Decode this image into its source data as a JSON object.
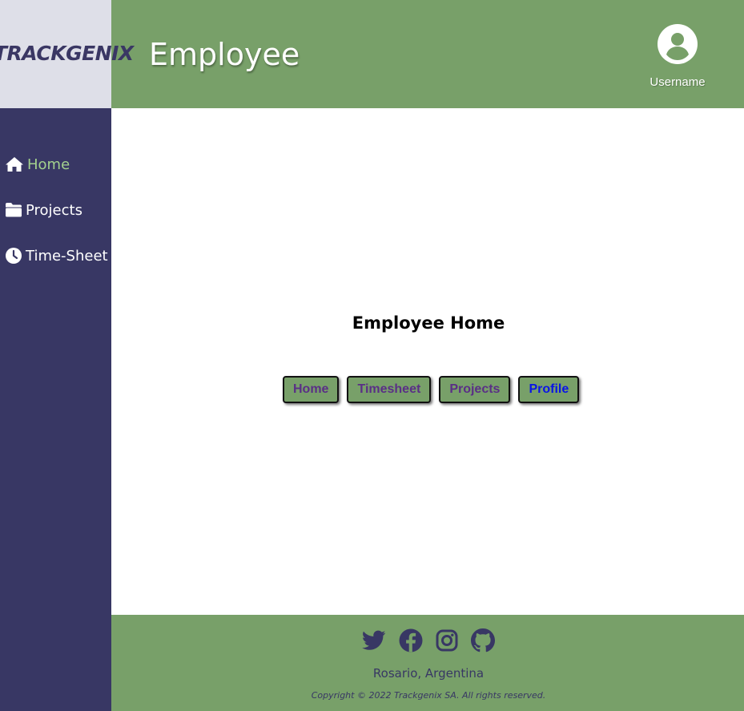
{
  "brand": {
    "logo_text": "TRACKGENIX"
  },
  "header": {
    "title": "Employee",
    "username": "Username"
  },
  "sidebar": {
    "items": [
      {
        "label": "Home",
        "icon": "home-icon",
        "active": true
      },
      {
        "label": "Projects",
        "icon": "folder-icon",
        "active": false
      },
      {
        "label": "Time-Sheet",
        "icon": "clock-icon",
        "active": false
      }
    ]
  },
  "main": {
    "title": "Employee Home",
    "buttons": [
      {
        "label": "Home"
      },
      {
        "label": "Timesheet"
      },
      {
        "label": "Projects"
      },
      {
        "label": "Profile"
      }
    ]
  },
  "footer": {
    "social": [
      "twitter-icon",
      "facebook-icon",
      "instagram-icon",
      "github-icon"
    ],
    "location": "Rosario, Argentina",
    "copyright": "Copyright © 2022 Trackgenix SA. All rights reserved."
  },
  "colors": {
    "header_green": "#78a069",
    "sidebar_navy": "#383764",
    "logo_bg": "#dedfe8",
    "active_nav": "#a3d18e",
    "button_text": "#5a2f86",
    "profile_text": "#0a14e6"
  }
}
